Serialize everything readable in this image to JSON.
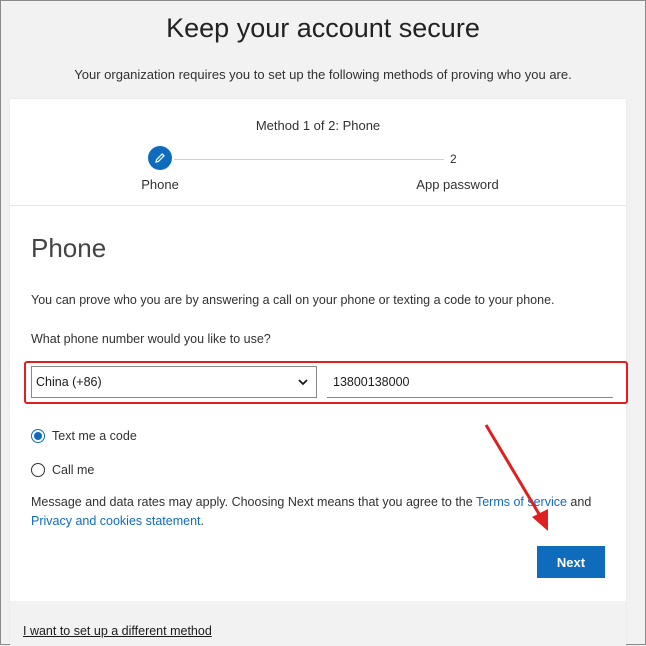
{
  "header": {
    "title": "Keep your account secure",
    "subtitle": "Your organization requires you to set up the following methods of proving who you are."
  },
  "progress": {
    "heading": "Method 1 of 2: Phone",
    "step1_label": "Phone",
    "step2_number": "2",
    "step2_label": "App password"
  },
  "phone": {
    "heading": "Phone",
    "description": "You can prove who you are by answering a call on your phone or texting a code to your phone.",
    "question": "What phone number would you like to use?",
    "country_value": "China (+86)",
    "number_value": "13800138000",
    "options": [
      {
        "label": "Text me a code",
        "checked": true
      },
      {
        "label": "Call me",
        "checked": false
      }
    ],
    "terms_prefix": "Message and data rates may apply. Choosing Next means that you agree to the ",
    "terms_link": "Terms of service",
    "terms_and": " and ",
    "privacy_link": "Privacy and cookies statement",
    "terms_suffix": ".",
    "next_label": "Next"
  },
  "footer": {
    "different_method": "I want to set up a different method"
  },
  "colors": {
    "accent": "#0f6cbd",
    "highlight": "#e02020"
  }
}
